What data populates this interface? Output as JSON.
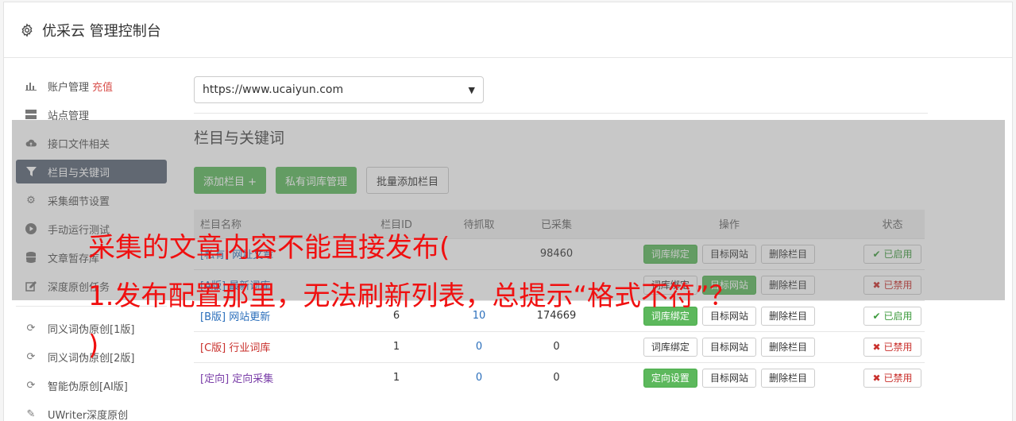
{
  "header": {
    "title": "优采云 管理控制台"
  },
  "sidebar": {
    "items": [
      {
        "label": "账户管理",
        "extra": "充值"
      },
      {
        "label": "站点管理"
      },
      {
        "label": "接口文件相关"
      },
      {
        "label": "栏目与关键词"
      },
      {
        "label": "采集细节设置"
      },
      {
        "label": "手动运行测试"
      },
      {
        "label": "文章暂存库"
      },
      {
        "label": "深度原创任务"
      }
    ],
    "items2": [
      {
        "label": "同义词伪原创[1版]"
      },
      {
        "label": "同义词伪原创[2版]"
      },
      {
        "label": "智能伪原创[AI版]"
      },
      {
        "label": "UWriter深度原创"
      }
    ]
  },
  "main": {
    "site_select": "https://www.ucaiyun.com",
    "section_title": "栏目与关键词",
    "buttons": {
      "add": "添加栏目 +",
      "private": "私有词库管理",
      "batch": "批量添加栏目"
    },
    "table": {
      "headers": [
        "栏目名称",
        "栏目ID",
        "待抓取",
        "已采集",
        "操作",
        "状态"
      ],
      "rows": [
        {
          "tag": "[私有]",
          "name": "网址文章",
          "id": "",
          "fetch": "",
          "done": "98460",
          "op1": "词库绑定",
          "op2": "目标网站",
          "op3": "删除栏目",
          "status": "已启用"
        },
        {
          "tag": "[A版]",
          "name": "最新词库",
          "id": "",
          "fetch": "",
          "done": "",
          "op1": "词库绑定",
          "op2": "目标网站",
          "op3": "删除栏目",
          "status": "已禁用"
        },
        {
          "tag": "[B版]",
          "name": "网站更新",
          "id": "6",
          "fetch": "10",
          "done": "174669",
          "op1": "词库绑定",
          "op2": "目标网站",
          "op3": "删除栏目",
          "status": "已启用"
        },
        {
          "tag": "[C版]",
          "name": "行业词库",
          "id": "1",
          "fetch": "0",
          "done": "0",
          "op1": "词库绑定",
          "op2": "目标网站",
          "op3": "删除栏目",
          "status": "已禁用"
        },
        {
          "tag": "[定向]",
          "name": "定向采集",
          "id": "1",
          "fetch": "0",
          "done": "0",
          "op1": "定向设置",
          "op2": "目标网站",
          "op3": "删除栏目",
          "status": "已禁用"
        }
      ]
    }
  },
  "overlay_text": {
    "line1": "采集的文章内容不能直接发布(",
    "line2": "1.发布配置那里，无法刷新列表，总提示“格式不符”？",
    "line3": ")"
  },
  "colors": {
    "accent_green": "#5cb85c",
    "active_nav": "#596475",
    "overlay_red": "#f01010"
  }
}
